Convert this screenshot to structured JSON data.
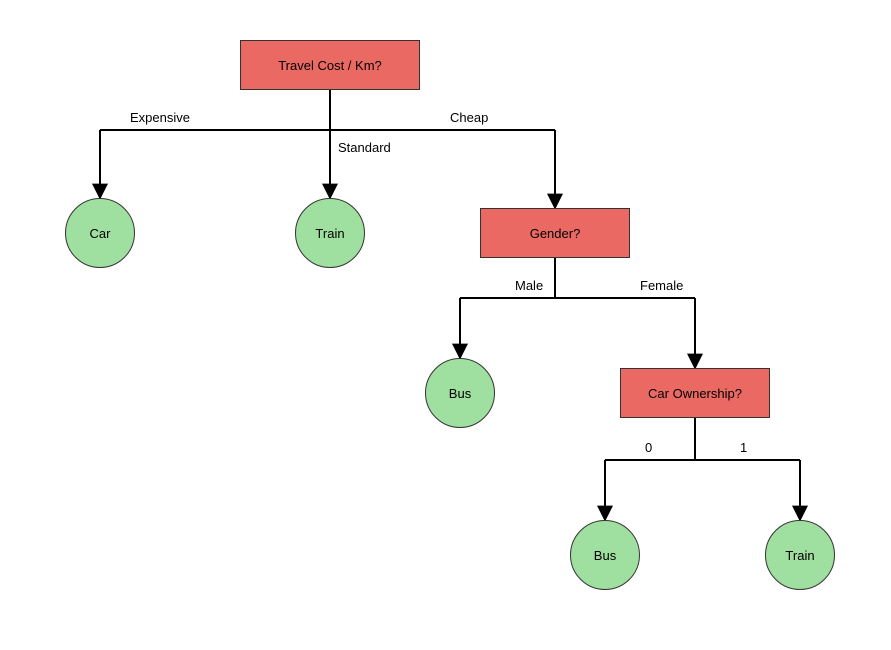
{
  "chart_data": {
    "type": "decision-tree",
    "nodes": [
      {
        "id": "root",
        "kind": "decision",
        "label": "Travel Cost / Km?"
      },
      {
        "id": "car",
        "kind": "leaf",
        "label": "Car"
      },
      {
        "id": "train1",
        "kind": "leaf",
        "label": "Train"
      },
      {
        "id": "gender",
        "kind": "decision",
        "label": "Gender?"
      },
      {
        "id": "bus1",
        "kind": "leaf",
        "label": "Bus"
      },
      {
        "id": "owner",
        "kind": "decision",
        "label": "Car Ownership?"
      },
      {
        "id": "bus2",
        "kind": "leaf",
        "label": "Bus"
      },
      {
        "id": "train2",
        "kind": "leaf",
        "label": "Train"
      }
    ],
    "edges": [
      {
        "from": "root",
        "to": "car",
        "label": "Expensive"
      },
      {
        "from": "root",
        "to": "train1",
        "label": "Standard"
      },
      {
        "from": "root",
        "to": "gender",
        "label": "Cheap"
      },
      {
        "from": "gender",
        "to": "bus1",
        "label": "Male"
      },
      {
        "from": "gender",
        "to": "owner",
        "label": "Female"
      },
      {
        "from": "owner",
        "to": "bus2",
        "label": "0"
      },
      {
        "from": "owner",
        "to": "train2",
        "label": "1"
      }
    ]
  },
  "colors": {
    "decision": "#ea6962",
    "leaf": "#9fdf9f",
    "line": "#000000"
  }
}
